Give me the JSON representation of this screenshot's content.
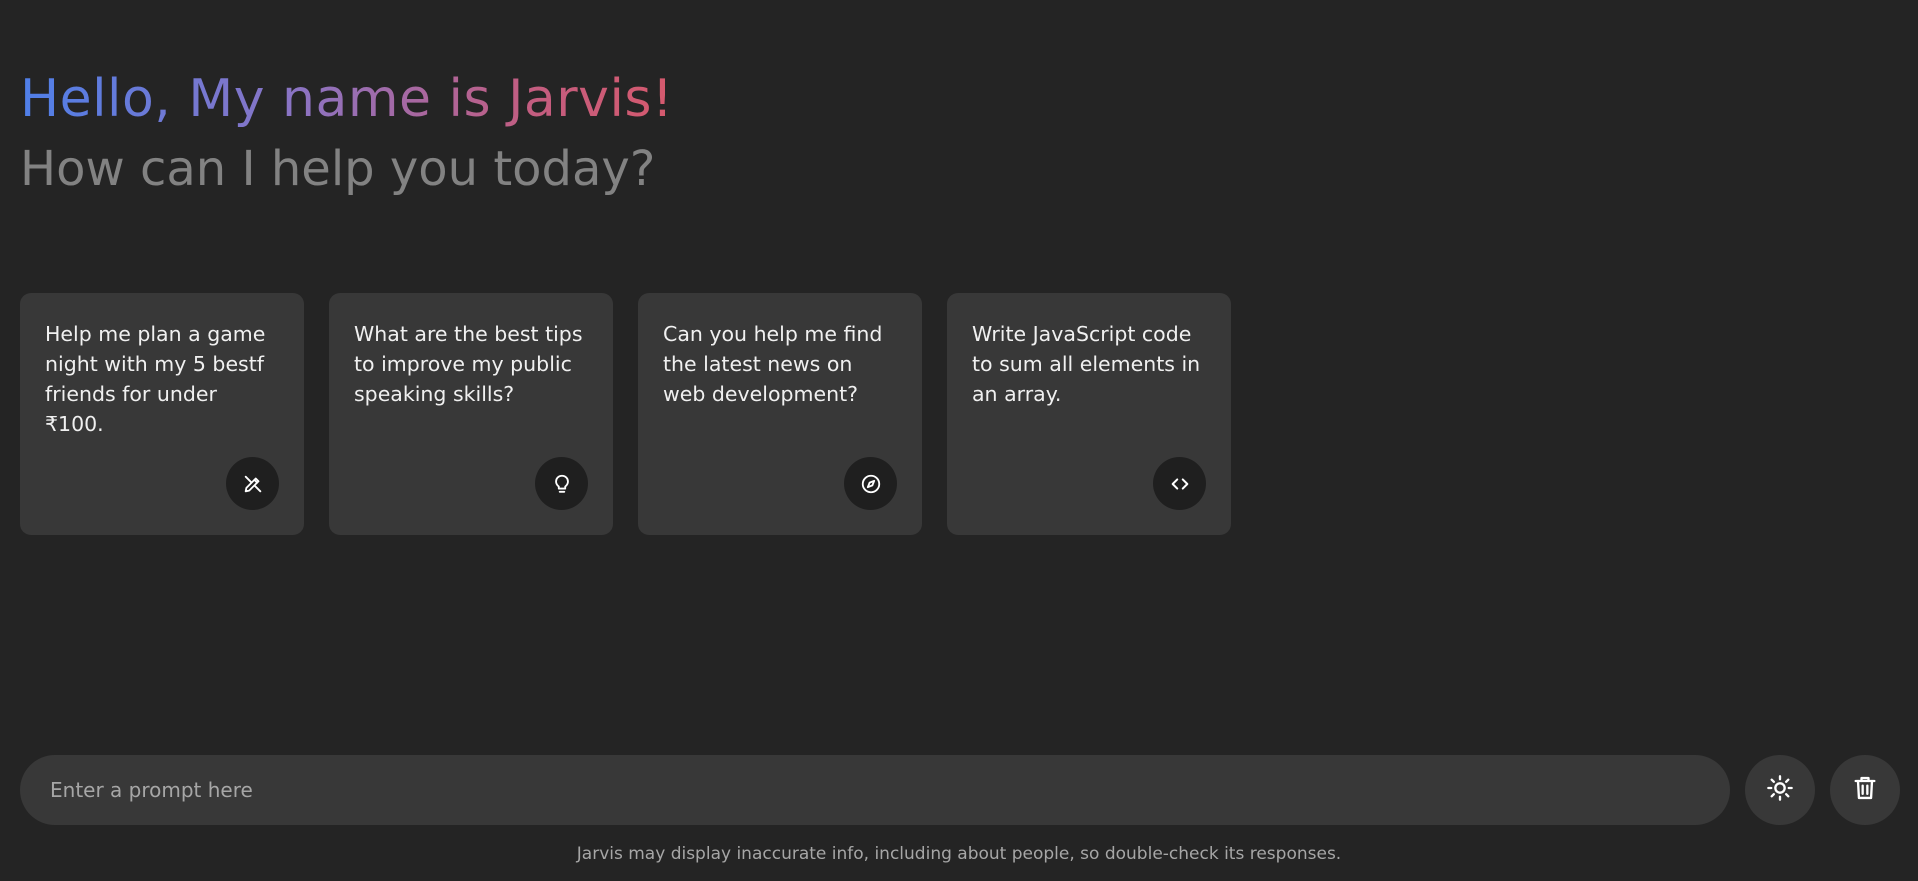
{
  "header": {
    "title": "Hello, My name is Jarvis!",
    "subtitle": "How can I help you today?"
  },
  "suggestions": [
    {
      "text": "Help me plan a game night with my 5 bestf friends for under ₹100.",
      "icon": "draw-icon"
    },
    {
      "text": "What are the best tips to improve my public speaking skills?",
      "icon": "lightbulb-icon"
    },
    {
      "text": "Can you help me find the latest news on web development?",
      "icon": "explore-icon"
    },
    {
      "text": "Write JavaScript code to sum all elements in an array.",
      "icon": "code-icon"
    }
  ],
  "prompt": {
    "placeholder": "Enter a prompt here",
    "value": ""
  },
  "actions": {
    "theme_icon": "sun-icon",
    "delete_icon": "trash-icon"
  },
  "disclaimer": "Jarvis may display inaccurate info, including about people, so double-check its responses.",
  "colors": {
    "background": "#242424",
    "card": "#383838",
    "icon_bg": "#1f1f1f",
    "gradient_start": "#4f7fe8",
    "gradient_end": "#d9596a",
    "subtitle": "#828282"
  }
}
